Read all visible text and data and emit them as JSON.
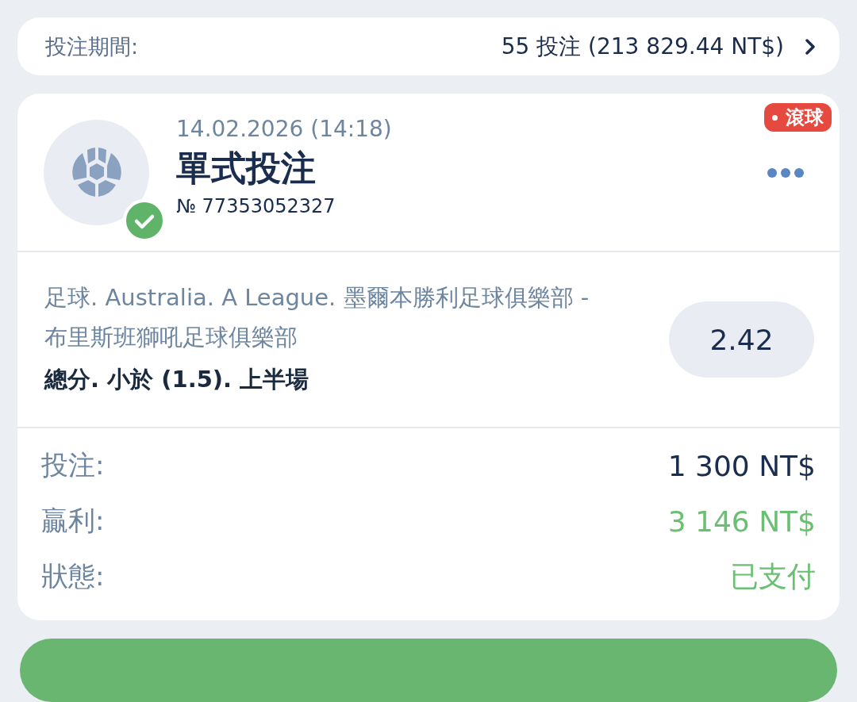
{
  "period": {
    "label": "投注期間:",
    "summary": "55 投注 (213 829.44 NT$)"
  },
  "bet": {
    "date": "14.02.2026 (14:18)",
    "type": "單式投注",
    "number": "№ 77353052327",
    "settled": true,
    "live_badge": "滾球",
    "event": "足球. Australia. A League. 墨爾本勝利足球俱樂部 - 布里斯班獅吼足球俱樂部",
    "market": "總分. 小於 (1.5). 上半場",
    "odds": "2.42",
    "rows": [
      {
        "label": "投注:",
        "value": "1 300 NT$",
        "kind": "plain"
      },
      {
        "label": "贏利:",
        "value": "3 146 NT$",
        "kind": "positive"
      },
      {
        "label": "狀態:",
        "value": "已支付",
        "kind": "positive"
      }
    ]
  }
}
